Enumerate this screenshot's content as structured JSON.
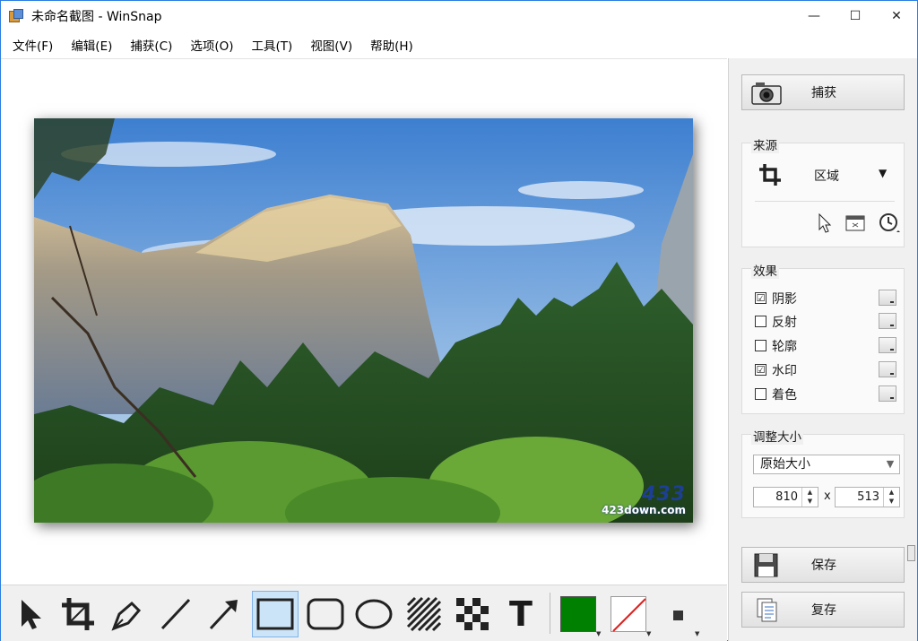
{
  "window": {
    "title": "未命名截图 - WinSnap"
  },
  "window_controls": {
    "minimize": "—",
    "maximize": "☐",
    "close": "✕"
  },
  "menu": [
    "文件(F)",
    "编辑(E)",
    "捕获(C)",
    "选项(O)",
    "工具(T)",
    "视图(V)",
    "帮助(H)"
  ],
  "image": {
    "watermark_big": "433",
    "watermark_small": "423down.com"
  },
  "panel": {
    "capture_label": "捕获",
    "source": {
      "title": "来源",
      "mode": "区域"
    },
    "effects": {
      "title": "效果",
      "items": [
        {
          "label": "阴影",
          "checked": "☑"
        },
        {
          "label": "反射",
          "checked": ""
        },
        {
          "label": "轮廓",
          "checked": ""
        },
        {
          "label": "水印",
          "checked": "☑"
        },
        {
          "label": "着色",
          "checked": ""
        }
      ]
    },
    "resize": {
      "title": "调整大小",
      "mode": "原始大小",
      "width": "810",
      "height": "513",
      "separator": "x"
    },
    "save_label": "保存",
    "copy_label": "复存"
  },
  "toolbar": {
    "tools": [
      "pointer",
      "crop",
      "pen",
      "line",
      "arrow",
      "rectangle",
      "rounded-rectangle",
      "ellipse",
      "hatch",
      "pixelate",
      "text"
    ],
    "selected_tool": "rectangle",
    "text_tool_glyph": "T",
    "colors": {
      "foreground": "#008000",
      "background": "none",
      "accent": "#2b7de1"
    }
  }
}
